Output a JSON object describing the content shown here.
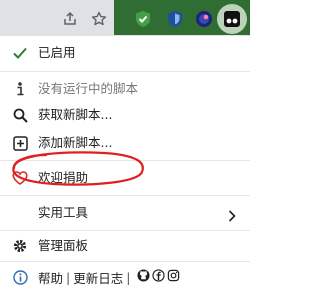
{
  "colors": {
    "toolbar": "#dee1e6",
    "toolbar_active": "#2f6d33",
    "check": "#2e7d32",
    "heart": "#d32f2f",
    "annotation": "#e02020"
  },
  "toolbar": {
    "icons": [
      "share-icon",
      "star-icon",
      "shield-check-icon",
      "shield-icon",
      "globe-icon",
      "tampermonkey-icon"
    ]
  },
  "menu": {
    "enabled_label": "已启用",
    "no_script_label": "没有运行中的脚本",
    "get_scripts_label": "获取新脚本...",
    "add_script_label": "添加新脚本...",
    "donate_label": "欢迎捐助",
    "utilities_label": "实用工具",
    "dashboard_label": "管理面板",
    "help_label": "帮助",
    "separator": "|",
    "changelog_label": "更新日志",
    "footer_icons": [
      "github-icon",
      "facebook-icon",
      "instagram-icon"
    ]
  }
}
